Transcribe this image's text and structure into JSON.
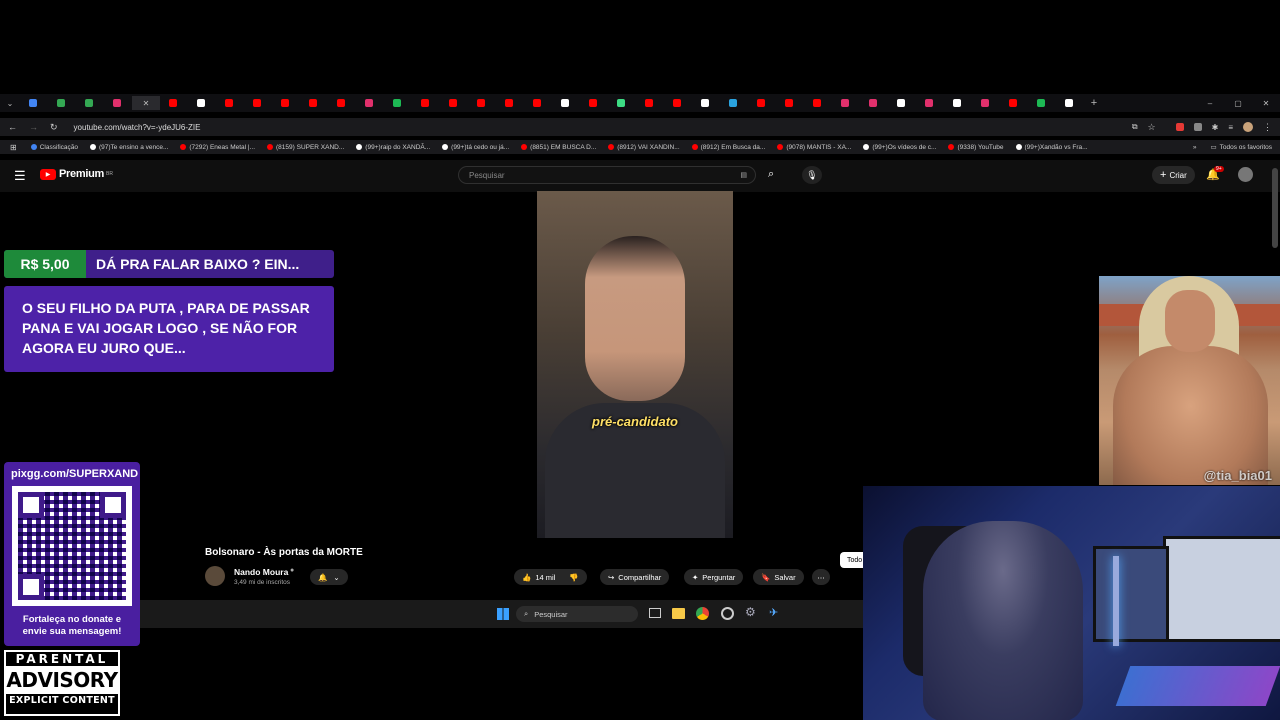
{
  "browser": {
    "url": "youtube.com/watch?v=-ydeJU6-ZIE",
    "bookmarks": [
      {
        "label": "Classificação",
        "color": "#4285f4"
      },
      {
        "label": "(97)Te ensino a vence...",
        "color": "#ffffff"
      },
      {
        "label": "(7292) Eneas Metal |...",
        "color": "#ff0000"
      },
      {
        "label": "(8159) SUPER XAND...",
        "color": "#ff0000"
      },
      {
        "label": "(99+)raip do XANDÃ...",
        "color": "#ffffff"
      },
      {
        "label": "(99+)tá cedo ou já...",
        "color": "#ffffff"
      },
      {
        "label": "(8851) EM BUSCA D...",
        "color": "#ff0000"
      },
      {
        "label": "(8912) VAI XANDIN...",
        "color": "#ff0000"
      },
      {
        "label": "(8912) Em Busca da...",
        "color": "#ff0000"
      },
      {
        "label": "(9078) MANTIS - XA...",
        "color": "#ff0000"
      },
      {
        "label": "(99+)Os vídeos de c...",
        "color": "#ffffff"
      },
      {
        "label": "(9338) YouTube",
        "color": "#ff0000"
      },
      {
        "label": "(99+)Xandão vs Fra...",
        "color": "#ffffff"
      }
    ],
    "all_bookmarks": "Todos os favoritos"
  },
  "youtube": {
    "logo": "Premium",
    "logo_sup": "BR",
    "search_placeholder": "Pesquisar",
    "create_label": "Criar",
    "notif_count": "9+"
  },
  "video": {
    "caption": "pré-candidato",
    "title": "Bolsonaro - Às portas da MORTE",
    "channel": "Nando Moura",
    "subscribers": "3,49 mi de inscritos",
    "likes": "14 mil",
    "share_label": "Compartilhar",
    "ask_label": "Perguntar",
    "save_label": "Salvar",
    "chip_partial": "Todo"
  },
  "donation": {
    "amount": "R$ 5,00",
    "title": "DÁ PRA FALAR BAIXO ? EIN...",
    "message": "O SEU FILHO DA PUTA , PARA DE PASSAR PANA E VAI JOGAR LOGO , SE NÃO FOR AGORA EU JURO QUE..."
  },
  "pix": {
    "url": "pixgg.com/SUPERXAND",
    "footer": "Fortaleça no donate e envie sua mensagem!"
  },
  "taskbar": {
    "search_placeholder": "Pesquisar"
  },
  "overlay": {
    "watermark": "@tia_bia01"
  },
  "advisory": {
    "line1": "PARENTAL",
    "line2": "ADVISORY",
    "line3": "EXPLICIT CONTENT"
  }
}
